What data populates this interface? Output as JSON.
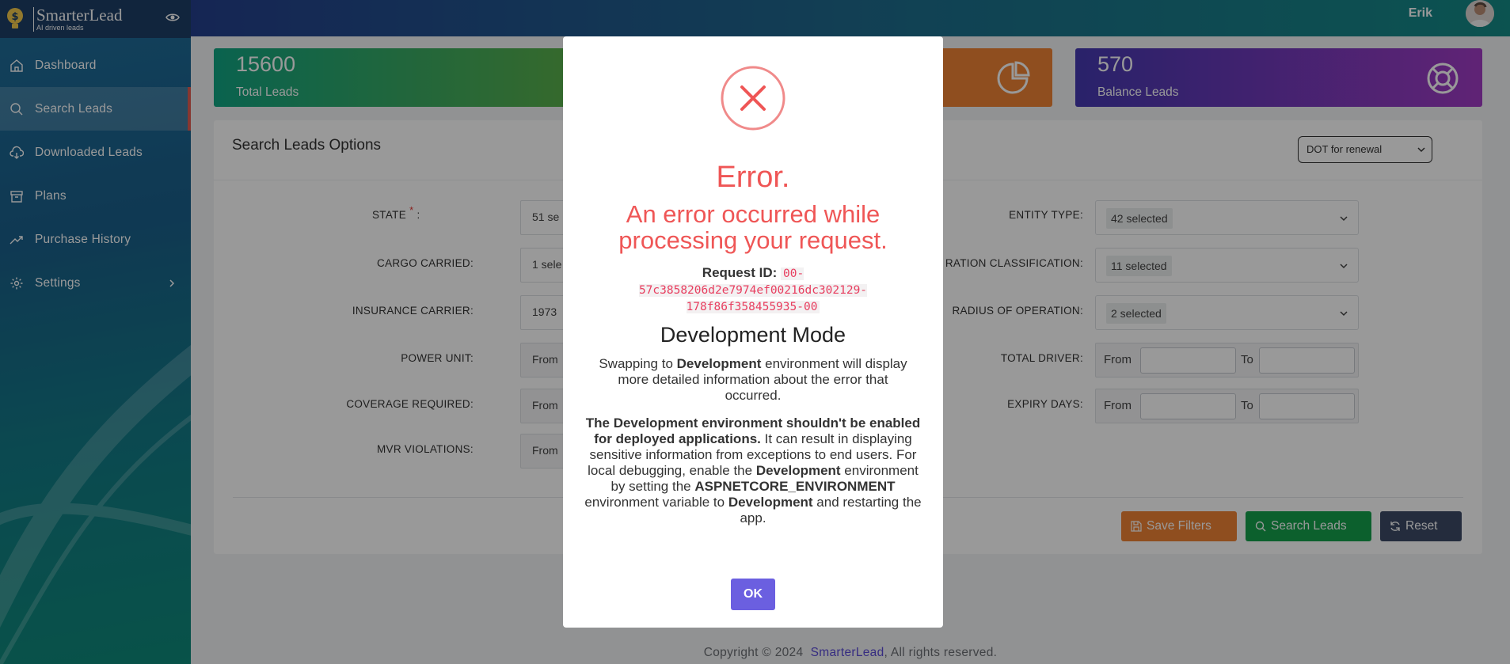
{
  "app": {
    "brand_name": "SmarterLead",
    "brand_tagline": "AI driven leads",
    "accent_color": "#e05d52"
  },
  "sidebar": {
    "items": [
      {
        "label": "Dashboard",
        "icon": "home-icon"
      },
      {
        "label": "Search Leads",
        "icon": "search-icon",
        "active": true
      },
      {
        "label": "Downloaded Leads",
        "icon": "cloud-download-icon"
      },
      {
        "label": "Plans",
        "icon": "archive-icon"
      },
      {
        "label": "Purchase History",
        "icon": "trending-up-icon"
      },
      {
        "label": "Settings",
        "icon": "gear-icon",
        "has_submenu": true
      }
    ]
  },
  "header": {
    "user_name": "Erik"
  },
  "stats": [
    {
      "value": "15600",
      "label": "Total Leads",
      "icon": "none"
    },
    {
      "value": "",
      "label": "",
      "icon": "pie-chart-icon"
    },
    {
      "value": "570",
      "label": "Balance Leads",
      "icon": "lifebuoy-icon"
    }
  ],
  "search_options": {
    "title": "Search Leads Options",
    "dot_select_value": "DOT for renewal",
    "left_fields": [
      {
        "label": "STATE",
        "required": true,
        "value": "51 se"
      },
      {
        "label": "CARGO CARRIED:",
        "value": "1 sele"
      },
      {
        "label": "INSURANCE CARRIER:",
        "value": "1973"
      },
      {
        "label": "POWER UNIT:",
        "value": "From"
      },
      {
        "label": "COVERAGE REQUIRED:",
        "value": "From"
      },
      {
        "label": "MVR VIOLATIONS:",
        "value": "From"
      }
    ],
    "right_fields": [
      {
        "label": "ENTITY TYPE:",
        "value": "42 selected"
      },
      {
        "label": "RATION CLASSIFICATION:",
        "value": "11 selected"
      },
      {
        "label": "RADIUS OF OPERATION:",
        "value": "2 selected"
      }
    ],
    "range_fields": [
      {
        "label": "TOTAL DRIVER:",
        "from": "From",
        "to": "To"
      },
      {
        "label": "EXPIRY DAYS:",
        "from": "From",
        "to": "To"
      }
    ],
    "buttons": {
      "save": "Save Filters",
      "search": "Search Leads",
      "reset": "Reset"
    }
  },
  "footer": {
    "prefix": "Copyright © 2024",
    "link": "SmarterLead",
    "suffix": ", All rights reserved."
  },
  "modal": {
    "title": "Error.",
    "message": "An error occurred while processing your request.",
    "request_id_label": "Request ID:",
    "request_id": "00-57c3858206d2e7974ef00216dc302129-178f86f358455935-00",
    "dev_title": "Development Mode",
    "p1": [
      "Swapping to ",
      "Development",
      " environment will display more detailed information about the error that occurred."
    ],
    "p2": [
      "The Development environment shouldn't be enabled for deployed applications.",
      " It can result in displaying sensitive information from exceptions to end users. For local debugging, enable the ",
      "Development",
      " environment by setting the ",
      "ASPNETCORE_ENVIRONMENT",
      " environment variable to ",
      "Development",
      " and restarting the app."
    ],
    "ok_label": "OK",
    "error_color": "#ef5656"
  }
}
